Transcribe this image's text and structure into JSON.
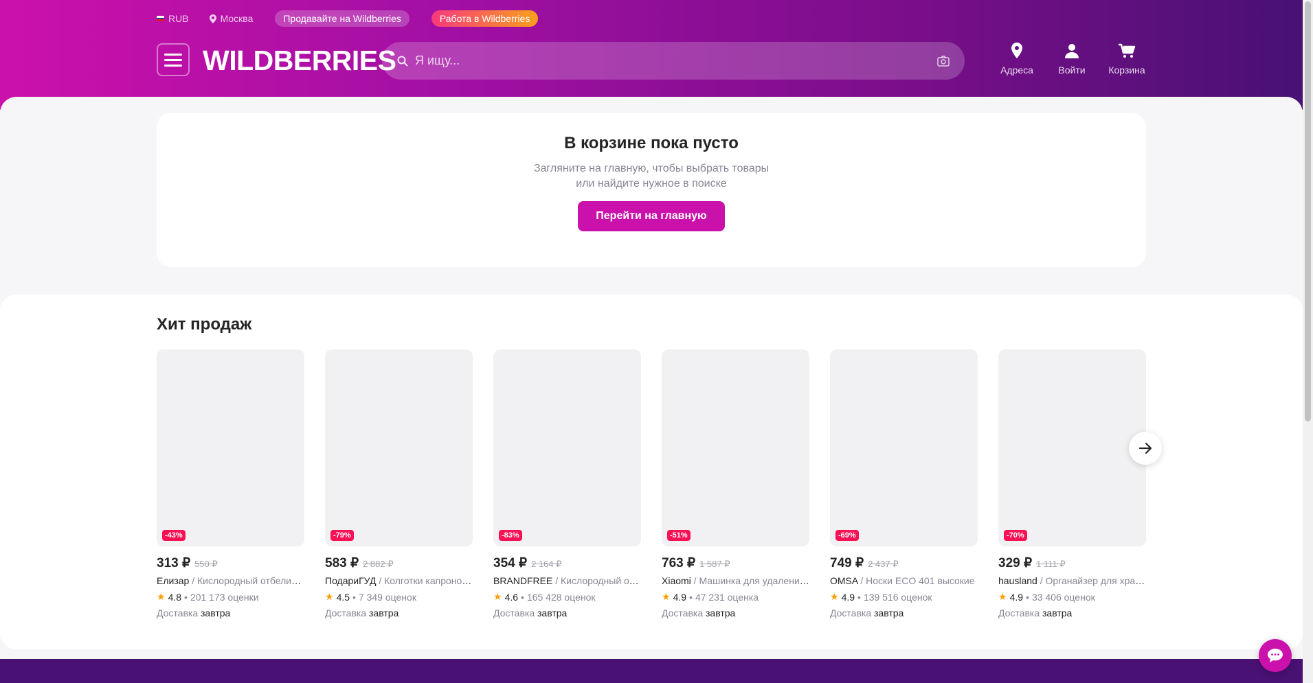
{
  "topbar": {
    "currency": "RUB",
    "city": "Москва",
    "sell_link": "Продавайте на Wildberries",
    "work_link": "Работа в Wildberries"
  },
  "header": {
    "logo": "WILDBERRIES",
    "search_placeholder": "Я ищу...",
    "nav": {
      "addresses": "Адреса",
      "login": "Войти",
      "cart": "Корзина"
    }
  },
  "cart_empty": {
    "title": "В корзине пока пусто",
    "line1": "Загляните на главную, чтобы выбрать товары",
    "line2": "или найдите нужное в поиске",
    "button": "Перейти на главную"
  },
  "hits": {
    "title": "Хит продаж",
    "products": [
      {
        "discount": "-43%",
        "price": "313 ₽",
        "old_price": "550 ₽",
        "brand": "Елизар",
        "desc": " / Кислородный отбеливатель",
        "rating": "4.8",
        "reviews": "201 173 оценки",
        "delivery_label": "Доставка",
        "delivery_when": "завтра"
      },
      {
        "discount": "-79%",
        "price": "583 ₽",
        "old_price": "2 882 ₽",
        "brand": "ПодариГУД",
        "desc": " / Колготки капроновые",
        "rating": "4.5",
        "reviews": "7 349 оценок",
        "delivery_label": "Доставка",
        "delivery_when": "завтра"
      },
      {
        "discount": "-83%",
        "price": "354 ₽",
        "old_price": "2 164 ₽",
        "brand": "BRANDFREE",
        "desc": " / Кислородный отбеливатель",
        "rating": "4.6",
        "reviews": "165 428 оценок",
        "delivery_label": "Доставка",
        "delivery_when": "завтра"
      },
      {
        "discount": "-51%",
        "price": "763 ₽",
        "old_price": "1 587 ₽",
        "brand": "Xiaomi",
        "desc": " / Машинка для удаления катышков",
        "rating": "4.9",
        "reviews": "47 231 оценка",
        "delivery_label": "Доставка",
        "delivery_when": "завтра"
      },
      {
        "discount": "-69%",
        "price": "749 ₽",
        "old_price": "2 437 ₽",
        "brand": "OMSA",
        "desc": " / Носки ECO 401 высокие",
        "rating": "4.9",
        "reviews": "139 516 оценок",
        "delivery_label": "Доставка",
        "delivery_when": "завтра"
      },
      {
        "discount": "-70%",
        "price": "329 ₽",
        "old_price": "1 111 ₽",
        "brand": "hausland",
        "desc": " / Органайзер для хранения",
        "rating": "4.9",
        "reviews": "33 406 оценок",
        "delivery_label": "Доставка",
        "delivery_when": "завтра"
      }
    ]
  },
  "colors": {
    "brand": "#cb11ab",
    "brand_dark": "#481173",
    "discount": "#f91155",
    "star": "#ff9c00"
  },
  "icons": {
    "search": "search-icon",
    "camera": "camera-icon",
    "pin": "location-pin-icon",
    "user": "user-icon",
    "cart": "cart-icon",
    "arrow": "arrow-right-icon",
    "chat": "chat-icon"
  }
}
